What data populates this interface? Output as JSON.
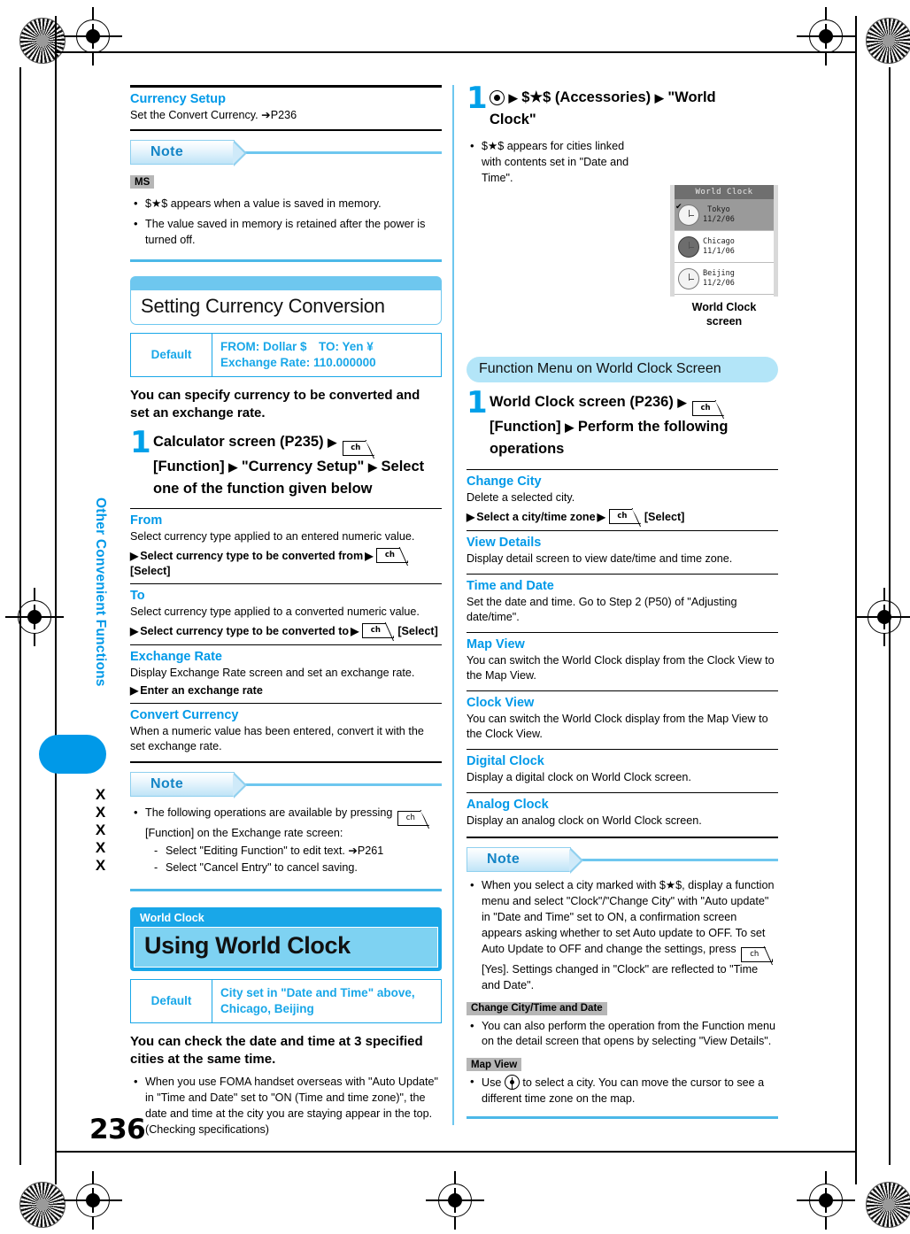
{
  "page": {
    "number": "236",
    "chapter": "Other Convenient Functions",
    "code": "XXXXX"
  },
  "left_column": {
    "currency_setup": {
      "title": "Currency Setup",
      "desc": "Set the Convert Currency. ➔P236"
    },
    "note1": {
      "label": "Note",
      "tag": "MS",
      "items": [
        "$★$ appears when a value is saved in memory.",
        "The value saved in memory is retained after the power is turned off."
      ]
    },
    "section_currency": {
      "heading": "Setting Currency Conversion",
      "default_key": "Default",
      "default_value_line1": "FROM: Dollar $ TO: Yen ¥",
      "default_value_line2": "Exchange Rate: 110.000000",
      "lead": "You can specify currency to be converted and set an exchange rate.",
      "step_number": "1",
      "step_text_a": "Calculator screen (P235)",
      "step_text_b": "[Function]",
      "step_text_c": "\"Currency Setup\"",
      "step_text_d": "Select one of the function given below",
      "functions": [
        {
          "title": "From",
          "desc": "Select currency type applied to an entered numeric value.",
          "op_a": "Select currency type to be converted from",
          "op_b": "[Select]"
        },
        {
          "title": "To",
          "desc": "Select currency type applied to a converted numeric value.",
          "op_a": "Select currency type to be converted to",
          "op_b": "[Select]"
        },
        {
          "title": "Exchange Rate",
          "desc": "Display Exchange Rate screen and set an exchange rate.",
          "op_a": "Enter an exchange rate",
          "op_b": ""
        },
        {
          "title": "Convert Currency",
          "desc": "When a numeric value has been entered, convert it with the set exchange rate.",
          "op_a": "",
          "op_b": ""
        }
      ]
    },
    "note2": {
      "label": "Note",
      "item_a": "The following operations are available by pressing",
      "item_b": "[Function] on the Exchange rate screen:",
      "sub_items": [
        "Select \"Editing Function\" to edit text. ➔P261",
        "Select \"Cancel Entry\" to cancel saving."
      ]
    },
    "section_world_clock": {
      "label": "World Clock",
      "heading": "Using World Clock",
      "default_key": "Default",
      "default_value_line1": "City set in \"Date and Time\" above,",
      "default_value_line2": "Chicago, Beijing",
      "lead": "You can check the date and time at 3 specified cities at the same time.",
      "bullet": "When you use FOMA handset overseas with \"Auto Update\" in \"Time and Date\" set to \"ON (Time and time zone)\", the date and time at the city you are staying appear in the top. (Checking specifications)"
    }
  },
  "right_column": {
    "step1": {
      "number": "1",
      "text_a": "$★$ (Accessories)",
      "text_b": "\"World Clock\"",
      "bullet": "$★$ appears for cities linked with contents set in \"Date and Time\"."
    },
    "screenshot": {
      "title": "World Clock",
      "caption_line1": "World Clock",
      "caption_line2": "screen",
      "rows": [
        {
          "city": "Tokyo",
          "date": "11/2/06",
          "checked": "✔",
          "selected": true
        },
        {
          "city": "Chicago",
          "date": "11/1/06",
          "checked": "",
          "selected": false
        },
        {
          "city": "Beijing",
          "date": "11/2/06",
          "checked": "",
          "selected": false
        }
      ]
    },
    "function_menu": {
      "pill": "Function Menu on World Clock Screen",
      "step_number": "1",
      "step_text_a": "World Clock screen (P236)",
      "step_text_b": "[Function]",
      "step_text_c": "Perform the following operations",
      "items": [
        {
          "title": "Change City",
          "desc": "Delete a selected city.",
          "op_a": "Select a city/time zone",
          "op_b": "[Select]"
        },
        {
          "title": "View Details",
          "desc": "Display detail screen to view date/time and time zone.",
          "op_a": "",
          "op_b": ""
        },
        {
          "title": "Time and Date",
          "desc": "Set the date and time. Go to Step 2 (P50) of \"Adjusting date/time\".",
          "op_a": "",
          "op_b": ""
        },
        {
          "title": "Map View",
          "desc": "You can switch the World Clock display from the Clock View to the Map View.",
          "op_a": "",
          "op_b": ""
        },
        {
          "title": "Clock View",
          "desc": "You can switch the World Clock display from the Map View to the Clock View.",
          "op_a": "",
          "op_b": ""
        },
        {
          "title": "Digital Clock",
          "desc": "Display a digital clock on World Clock screen.",
          "op_a": "",
          "op_b": ""
        },
        {
          "title": "Analog Clock",
          "desc": "Display an analog clock on World Clock screen.",
          "op_a": "",
          "op_b": ""
        }
      ]
    },
    "note": {
      "label": "Note",
      "bullet_a": "When you select a city marked with $★$, display a function menu and select \"Clock\"/\"Change City\" with \"Auto update\" in \"Date and Time\" set to ON, a confirmation screen appears asking whether to set Auto update to OFF. To set Auto Update to OFF and change the settings, press",
      "bullet_a_tail": "[Yes]. Settings changed in \"Clock\" are reflected to \"Time and Date\".",
      "tag_b": "Change City/Time and Date",
      "bullet_b": "You can also perform the operation from the Function menu on the detail screen that opens by selecting \"View Details\".",
      "tag_c": "Map View",
      "bullet_c_a": "Use",
      "bullet_c_b": "to select a city.  You can move the cursor to see a different time zone on the map."
    }
  },
  "icons": {
    "key_label": "ch",
    "arrow": "▶"
  },
  "colors": {
    "accent_blue": "#0099e8",
    "light_blue": "#6ec7ef",
    "header_blue": "#19a7e8",
    "pill_blue": "#b3e5f8"
  }
}
